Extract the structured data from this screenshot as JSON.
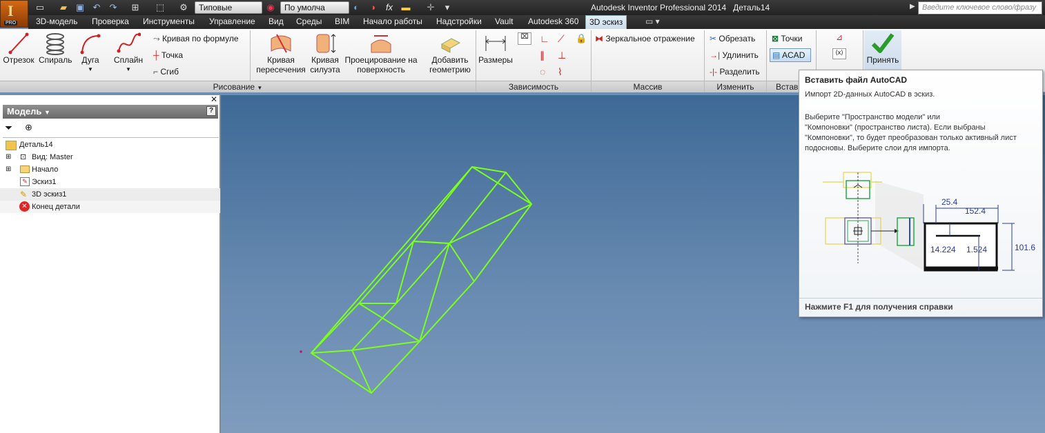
{
  "app": {
    "title": "Autodesk Inventor Professional 2014",
    "document": "Деталь14",
    "pro_badge": "PRO",
    "app_letter": "I",
    "search_placeholder": "Введите ключевое слово/фразу"
  },
  "quick_access": {
    "style_value": "Типовые",
    "appearance_value": "По умолча",
    "fx_label": "fx"
  },
  "menu_tabs": [
    {
      "label": "3D-модель",
      "active": false
    },
    {
      "label": "Проверка",
      "active": false
    },
    {
      "label": "Инструменты",
      "active": false
    },
    {
      "label": "Управление",
      "active": false
    },
    {
      "label": "Вид",
      "active": false
    },
    {
      "label": "Среды",
      "active": false
    },
    {
      "label": "BIM",
      "active": false
    },
    {
      "label": "Начало работы",
      "active": false
    },
    {
      "label": "Надстройки",
      "active": false
    },
    {
      "label": "Vault",
      "active": false
    },
    {
      "label": "Autodesk 360",
      "active": false
    },
    {
      "label": "3D эскиз",
      "active": true
    }
  ],
  "ribbon": {
    "draw": {
      "line": "Отрезок",
      "helix": "Спираль",
      "arc": "Дуга",
      "spline": "Сплайн",
      "eq_curve": "Кривая по формуле",
      "point": "Точка",
      "bend": "Сгиб",
      "intersect_1": "Кривая",
      "intersect_2": "пересечения",
      "silhouette_1": "Кривая",
      "silhouette_2": "силуэта",
      "project_1": "Проецирование на",
      "project_2": "поверхность",
      "include_1": "Добавить",
      "include_2": "геометрию",
      "group_label": "Рисование"
    },
    "constrain": {
      "dimension": "Размеры",
      "group_label": "Зависимость"
    },
    "pattern": {
      "mirror": "Зеркальное отражение",
      "group_label": "Массив"
    },
    "modify": {
      "trim": "Обрезать",
      "extend": "Удлинить",
      "split": "Разделить",
      "group_label": "Изменить"
    },
    "insert": {
      "points": "Точки",
      "acad": "ACAD",
      "group_label": "Вставить"
    },
    "exit": {
      "finish": "Принять"
    }
  },
  "browser": {
    "title": "Модель",
    "items": [
      {
        "label": "Деталь14",
        "icon": "part-icon"
      },
      {
        "label": "Вид: Master",
        "icon": "view-icon"
      },
      {
        "label": "Начало",
        "icon": "folder-icon"
      },
      {
        "label": "Эскиз1",
        "icon": "sketch-icon"
      },
      {
        "label": "3D эскиз1",
        "icon": "sketch3d-icon"
      },
      {
        "label": "Конец детали",
        "icon": "end-of-part-icon"
      }
    ]
  },
  "tooltip": {
    "title": "Вставить файл AutoCAD",
    "line1": "Импорт 2D-данных AutoCAD в эскиз.",
    "body_1": "Выберите \"Пространство модели\" или",
    "body_2": "\"Компоновки\" (пространство листа). Если выбраны",
    "body_3": "\"Компоновки\", то будет преобразован только активный лист",
    "body_4": "подосновы. Выберите слои для импорта.",
    "dim_a": "25.4",
    "dim_b": "152.4",
    "dim_c": "14.224",
    "dim_d": "1.524",
    "dim_e": "101.6",
    "footer": "Нажмите F1 для получения справки"
  },
  "colors": {
    "sketch_line": "#7cff1e",
    "accent_active": "#cddceb"
  }
}
